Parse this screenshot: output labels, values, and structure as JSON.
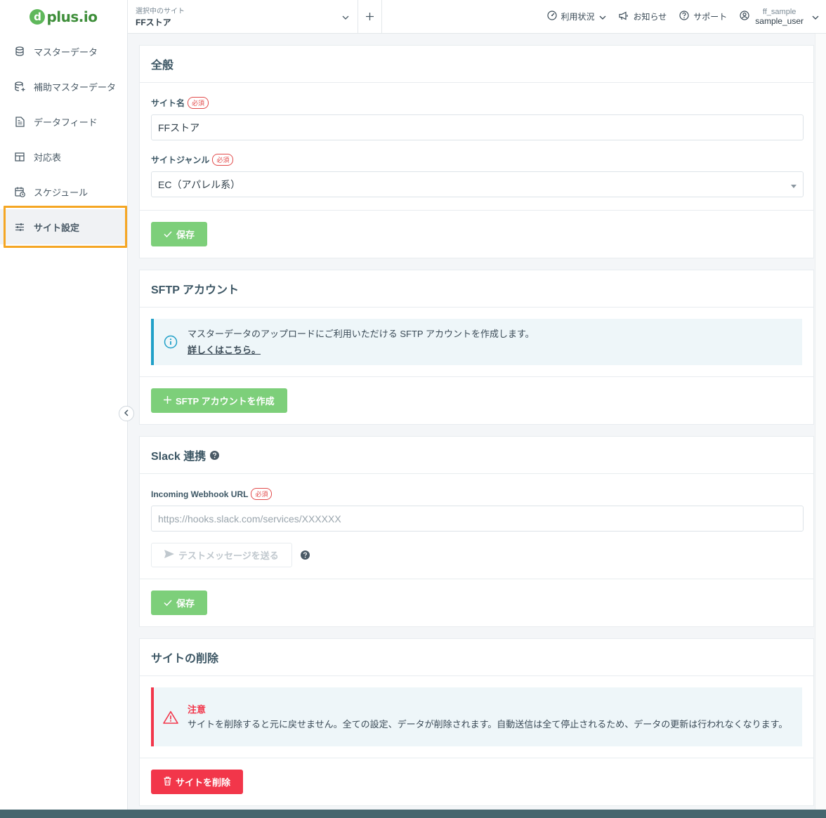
{
  "app": {
    "logo_text": "plus.io",
    "logo_mark": "d"
  },
  "sidebar": {
    "items": [
      {
        "label": "マスターデータ",
        "icon": "database-icon"
      },
      {
        "label": "補助マスターデータ",
        "icon": "database-plus-icon"
      },
      {
        "label": "データフィード",
        "icon": "document-icon"
      },
      {
        "label": "対応表",
        "icon": "table-icon"
      },
      {
        "label": "スケジュール",
        "icon": "calendar-clock-icon"
      },
      {
        "label": "サイト設定",
        "icon": "sliders-icon",
        "active": true
      }
    ]
  },
  "header": {
    "site_caption": "選択中のサイト",
    "site_name": "FFストア",
    "usage_label": "利用状況",
    "notice_label": "お知らせ",
    "support_label": "サポート",
    "user_org": "ff_sample",
    "user_name": "sample_user"
  },
  "general": {
    "title": "全般",
    "site_name_label": "サイト名",
    "required": "必須",
    "site_name_value": "FFストア",
    "genre_label": "サイトジャンル",
    "genre_value": "EC（アパレル系）",
    "save_label": "保存"
  },
  "sftp": {
    "title": "SFTP アカウント",
    "info_text": "マスターデータのアップロードにご利用いただける SFTP アカウントを作成します。",
    "info_link": "詳しくはこちら。",
    "create_label": "SFTP アカウントを作成"
  },
  "slack": {
    "title": "Slack 連携",
    "webhook_label": "Incoming Webhook URL",
    "required": "必須",
    "webhook_placeholder": "https://hooks.slack.com/services/XXXXXX",
    "test_label": "テストメッセージを送る",
    "save_label": "保存"
  },
  "delete": {
    "title": "サイトの削除",
    "warn_title": "注意",
    "warn_text": "サイトを削除すると元に戻せません。全ての設定、データが削除されます。自動送信は全て停止されるため、データの更新は行われなくなります。",
    "delete_label": "サイトを削除"
  },
  "colors": {
    "accent_green": "#7dcf7a",
    "danger_red": "#f2364a",
    "info_blue": "#20a0c8",
    "highlight_orange": "#f5a623"
  }
}
